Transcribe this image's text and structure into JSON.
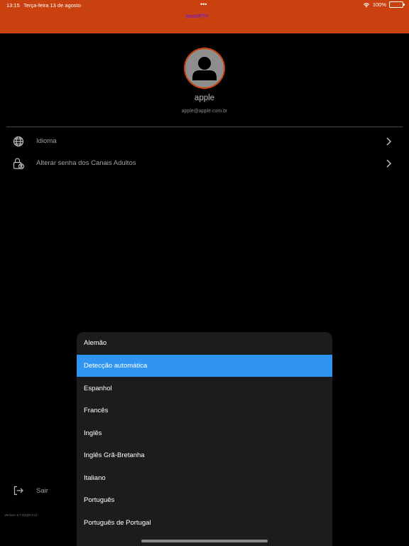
{
  "status_bar": {
    "time": "13:15",
    "date": "Terça-feira 13 de agosto",
    "dots": "•••",
    "battery": "100%"
  },
  "header": {
    "logo_text": "bestIPTV",
    "background_color": "#c9410e"
  },
  "profile": {
    "name": "apple",
    "email": "apple@apple.com.br",
    "avatar_icon": "person-icon"
  },
  "menu": {
    "items": [
      {
        "label": "Idioma",
        "icon": "globe-icon"
      },
      {
        "label": "Alterar senha dos Canais Adultos",
        "icon": "lock-person-icon"
      }
    ]
  },
  "footer": {
    "logout_label": "Sair",
    "version": "Version: 5.7.2(0)(0.0.4)"
  },
  "language_sheet": {
    "options": [
      "Alemão",
      "Detecção automática",
      "Espanhol",
      "Francês",
      "Inglês",
      "Inglês Grã-Bretanha",
      "Italiano",
      "Português",
      "Português de Portugal"
    ],
    "selected": "Detecção automática",
    "selected_color": "#2f95f0"
  }
}
